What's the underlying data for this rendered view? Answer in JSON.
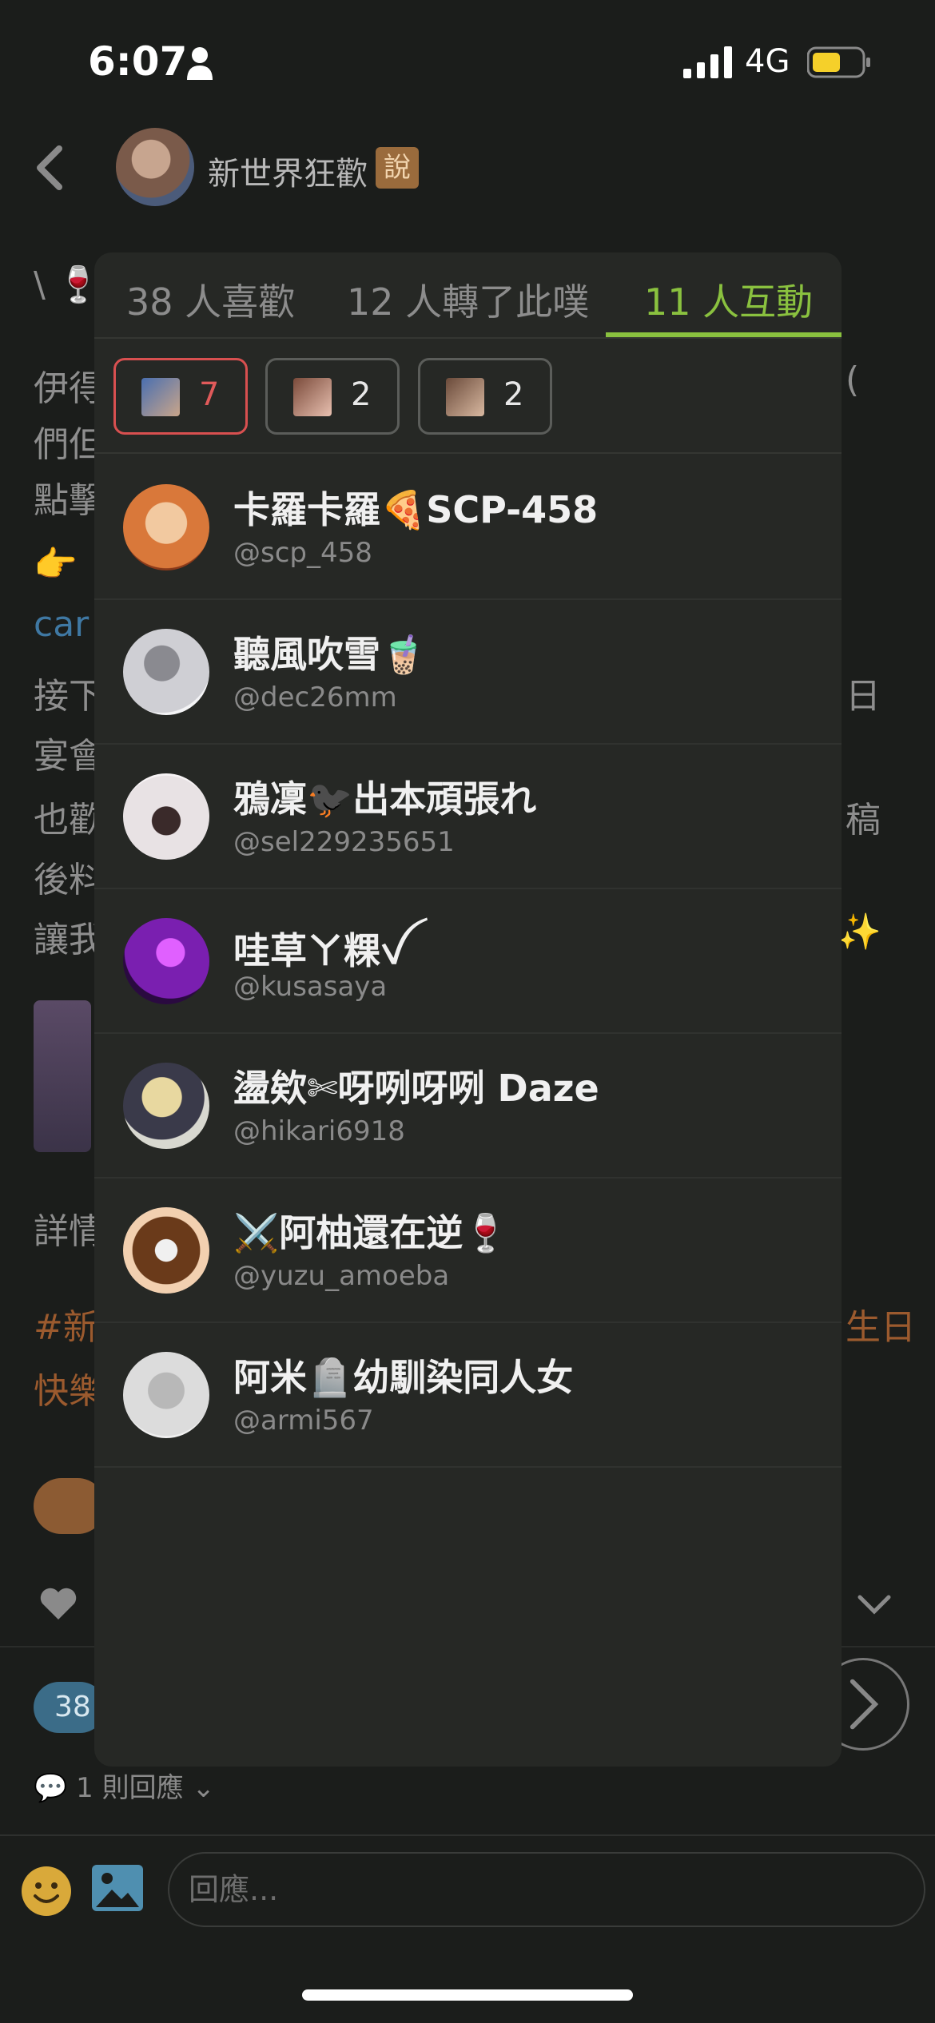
{
  "status_bar": {
    "time": "6:07",
    "network": "4G",
    "person_icon": "person-icon",
    "signal_icon": "signal-bars-icon",
    "battery_icon": "battery-icon"
  },
  "post": {
    "author_name": "新世界狂歡",
    "author_badge": "說",
    "lines": [
      "\\ 🍷",
      "伊得",
      "們但",
      "點擊",
      "👉",
      "car",
      "接下",
      "宴會",
      "也歡",
      "後料",
      "讓我",
      "詳情",
      "#新",
      "快樂"
    ],
    "right_fragments": [
      "(",
      "日",
      "稿",
      "✨",
      "生日"
    ],
    "like_count": "38",
    "reply_count_label": "1 則回應"
  },
  "popover": {
    "tabs": [
      {
        "label": "38 人喜歡"
      },
      {
        "label": "12 人轉了此噗"
      },
      {
        "label": "11 人互動"
      }
    ],
    "active_tab": 2,
    "chips": [
      {
        "count": "7",
        "selected": true
      },
      {
        "count": "2",
        "selected": false
      },
      {
        "count": "2",
        "selected": false
      }
    ],
    "users": [
      {
        "name": "卡羅卡羅🍕SCP-458",
        "handle": "@scp_458",
        "avatar_color": "#d9783a"
      },
      {
        "name": "聽風吹雪🧋",
        "handle": "@dec26mm",
        "avatar_color": "#cfcfd4"
      },
      {
        "name": "鴉凜🐦‍⬛出本頑張れ",
        "handle": "@sel229235651",
        "avatar_color": "#e8e2e4"
      },
      {
        "name": "哇草ㄚ粿ꪜ",
        "handle": "@kusasaya",
        "avatar_color": "#7a1fb0"
      },
      {
        "name": "盪欸✄呀咧呀咧 Daze",
        "handle": "@hikari6918",
        "avatar_color": "#c9c29a"
      },
      {
        "name": "⚔️阿柚還在逆🍷",
        "handle": "@yuzu_amoeba",
        "avatar_color": "#8a5a3a"
      },
      {
        "name": "阿米🪦幼馴染同人女",
        "handle": "@armi567",
        "avatar_color": "#dcdcdc"
      }
    ]
  },
  "reply_bar": {
    "placeholder": "回應..."
  },
  "colors": {
    "accent_green": "#8ac13f",
    "selected_red": "#d85050",
    "link_blue": "#3f78a3",
    "tag_orange": "#9b5a2e"
  }
}
